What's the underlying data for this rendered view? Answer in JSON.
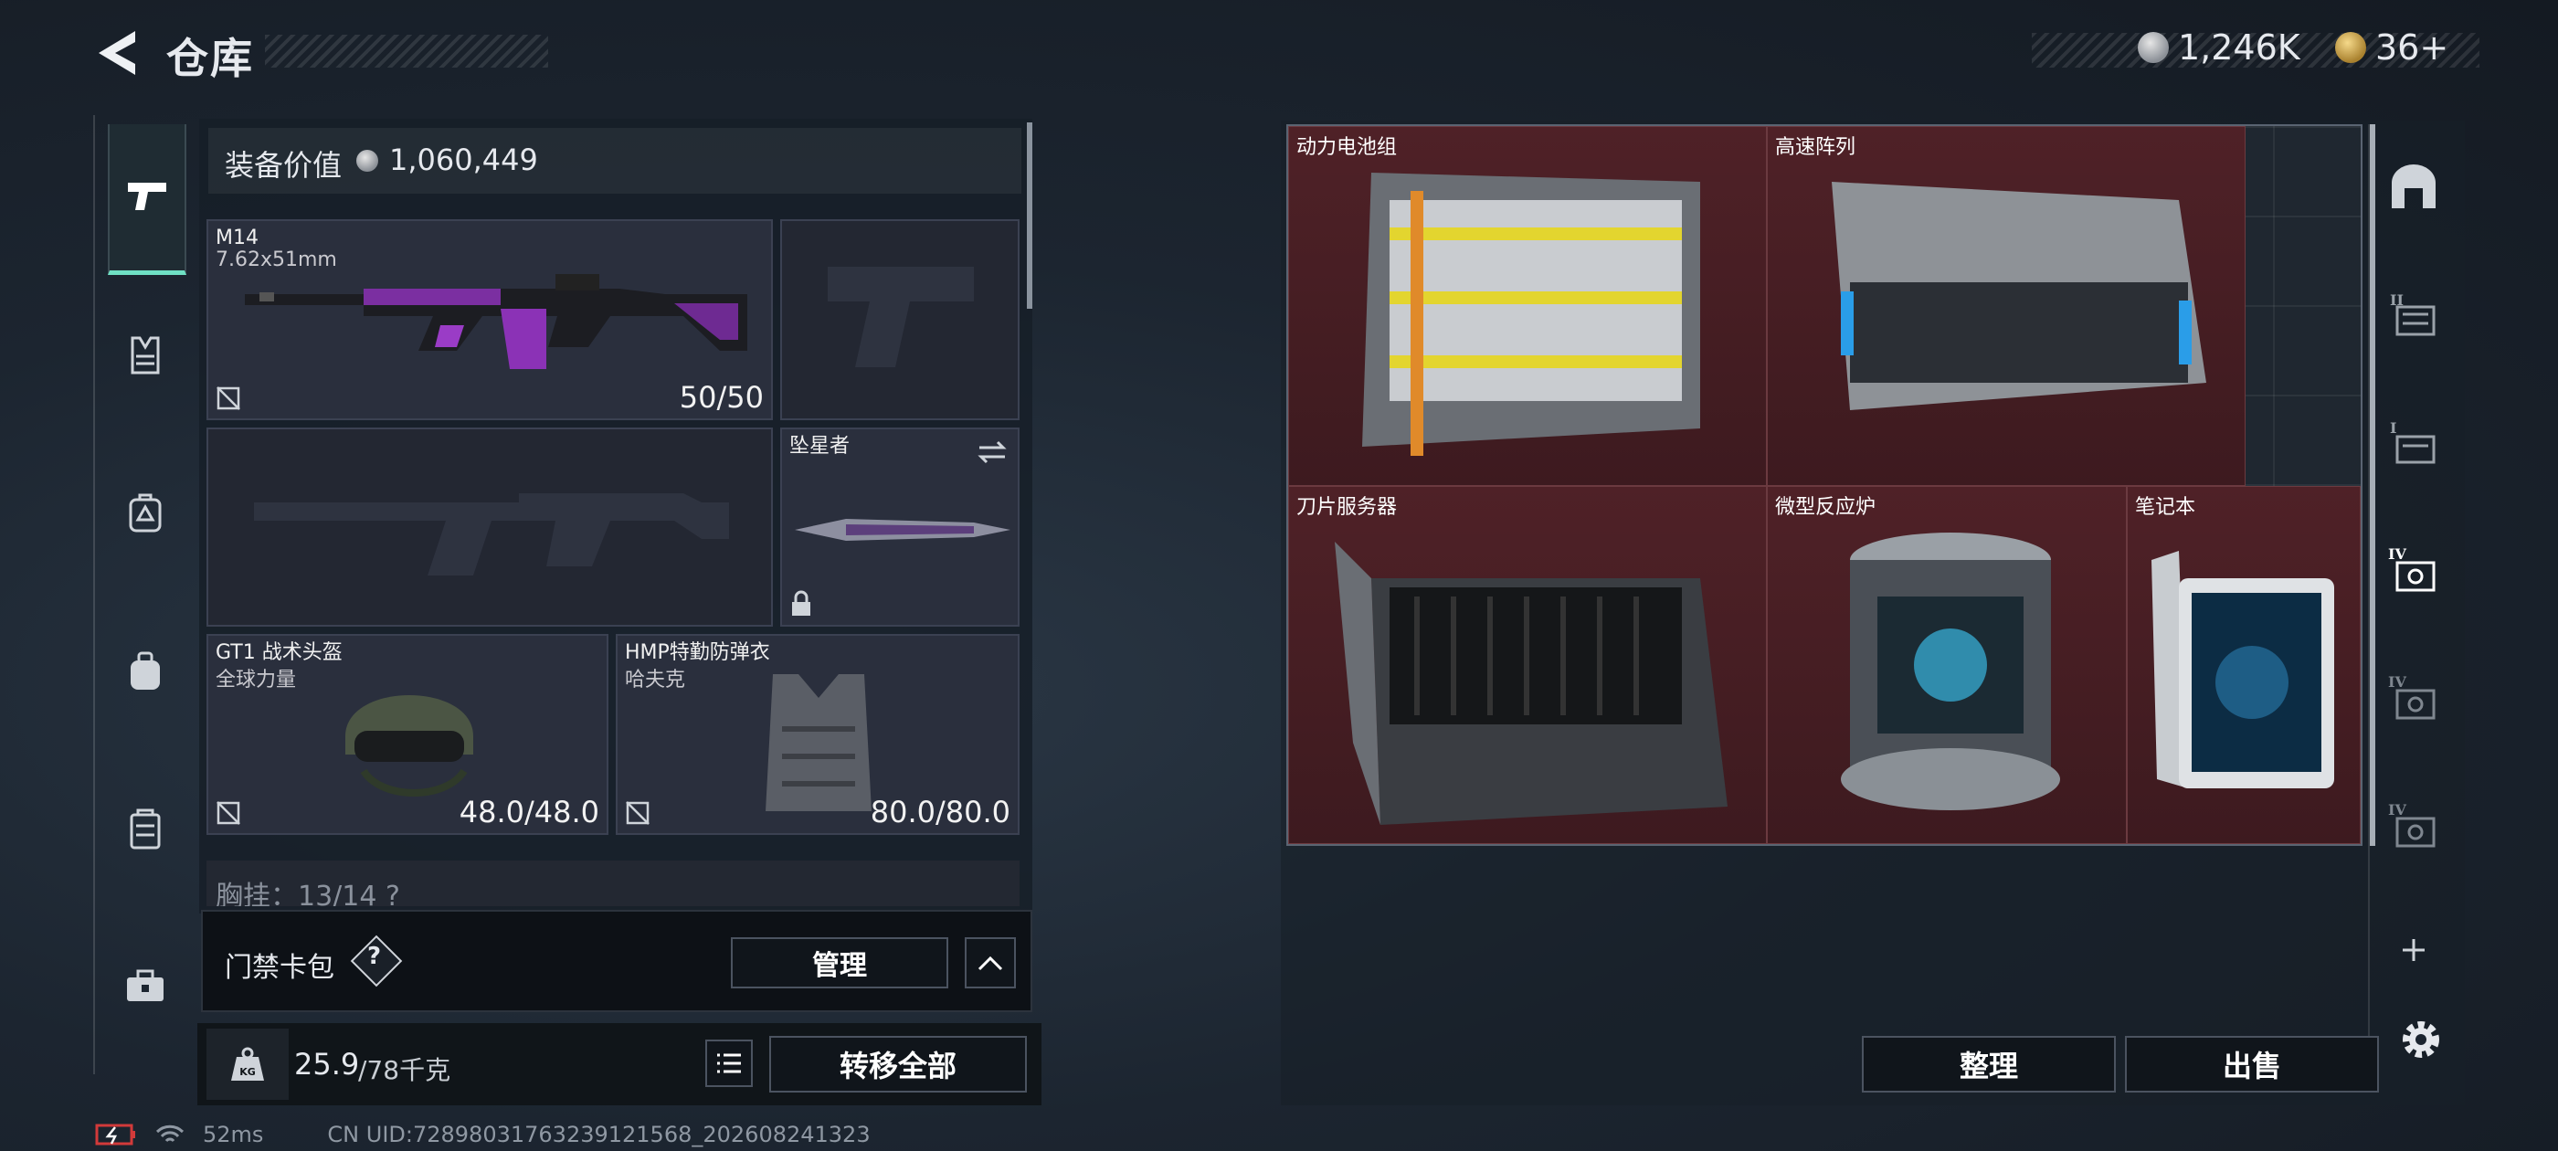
{
  "header": {
    "title": "仓库",
    "currency1": "1,246K",
    "currency2": "36+"
  },
  "equipment": {
    "value_label": "装备价值",
    "value": "1,060,449",
    "slots": {
      "primary": {
        "name": "M14",
        "sub": "7.62x51mm",
        "value": "50/50"
      },
      "melee": {
        "name": "坠星者"
      },
      "helmet": {
        "name": "GT1 战术头盔",
        "sub": "全球力量",
        "value": "48.0/48.0"
      },
      "armor": {
        "name": "HMP特勤防弹衣",
        "sub": "哈夫克",
        "value": "80.0/80.0"
      }
    },
    "chest_partial": "胸挂：13/14 ?"
  },
  "access_card": {
    "label": "门禁卡包",
    "help": "?",
    "manage": "管理"
  },
  "weight": {
    "current": "25.9",
    "max": "/78千克",
    "transfer_all": "转移全部"
  },
  "storage": {
    "items": [
      {
        "name": "动力电池组"
      },
      {
        "name": "高速阵列"
      },
      {
        "name": "刀片服务器"
      },
      {
        "name": "微型反应炉"
      },
      {
        "name": "笔记本"
      }
    ],
    "sort": "整理",
    "sell": "出售"
  },
  "status_bar": {
    "ping": "52ms",
    "uid": "CN UID:7289803176323912156​8_202608241323"
  },
  "colors": {
    "accent": "#6fe0c4",
    "item_bg": "#4a1f25",
    "slot_bg": "#2a2f3d"
  }
}
